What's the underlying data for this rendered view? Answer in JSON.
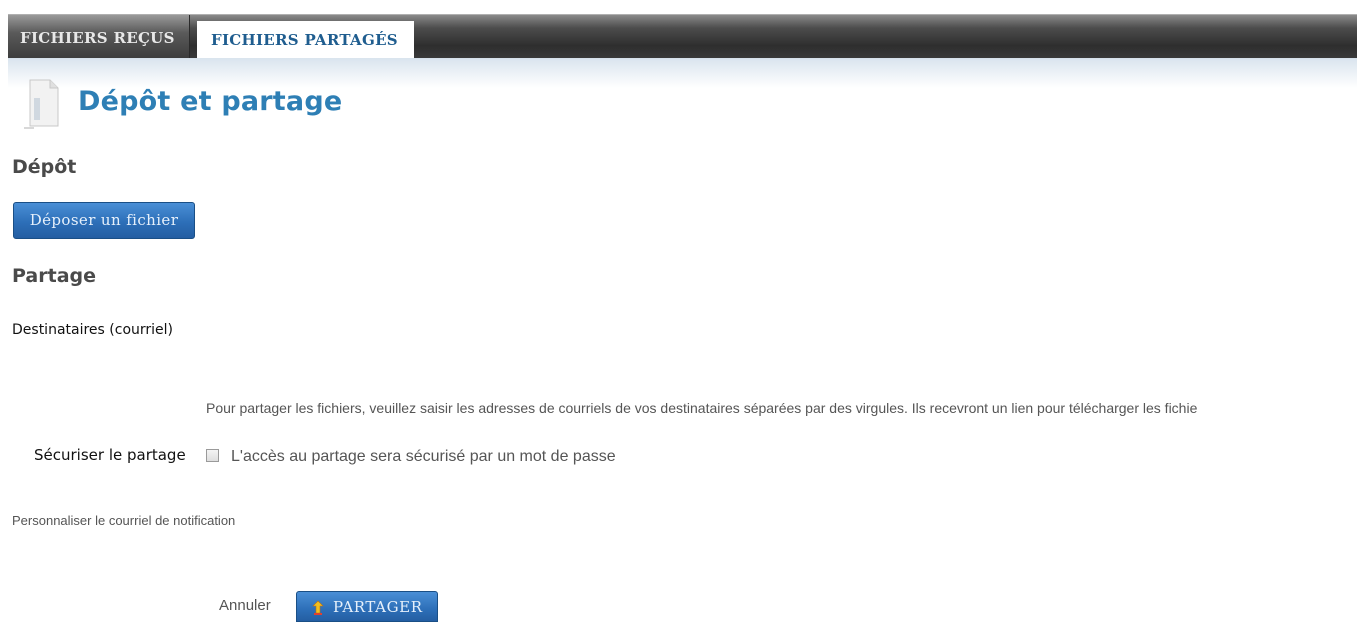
{
  "tabs": {
    "received_label": "FICHIERS REÇUS",
    "shared_label": "FICHIERS PARTAGÉS"
  },
  "header": {
    "title": "Dépôt et partage",
    "icon": "document-icon"
  },
  "depot": {
    "section_title": "Dépôt",
    "upload_button_label": "Déposer un fichier"
  },
  "partage": {
    "section_title": "Partage",
    "recipients_label": "Destinataires (courriel)",
    "recipients_value": "",
    "help_text": "Pour partager les fichiers, veuillez saisir les adresses de courriels de vos destinataires séparées par des virgules. Ils recevront un lien pour télécharger les fichie",
    "secure_label": "Sécuriser le partage",
    "secure_checkbox_label": "L'accès au partage sera sécurisé par un mot de passe",
    "secure_checked": false,
    "customize_link": "Personnaliser le courriel de notification"
  },
  "actions": {
    "cancel_label": "Annuler",
    "share_label": "PARTAGER",
    "share_icon": "share-icon"
  },
  "colors": {
    "accent": "#2e7fb5",
    "button": "#2d6fb8",
    "tab_active_text": "#1f5d8f"
  }
}
